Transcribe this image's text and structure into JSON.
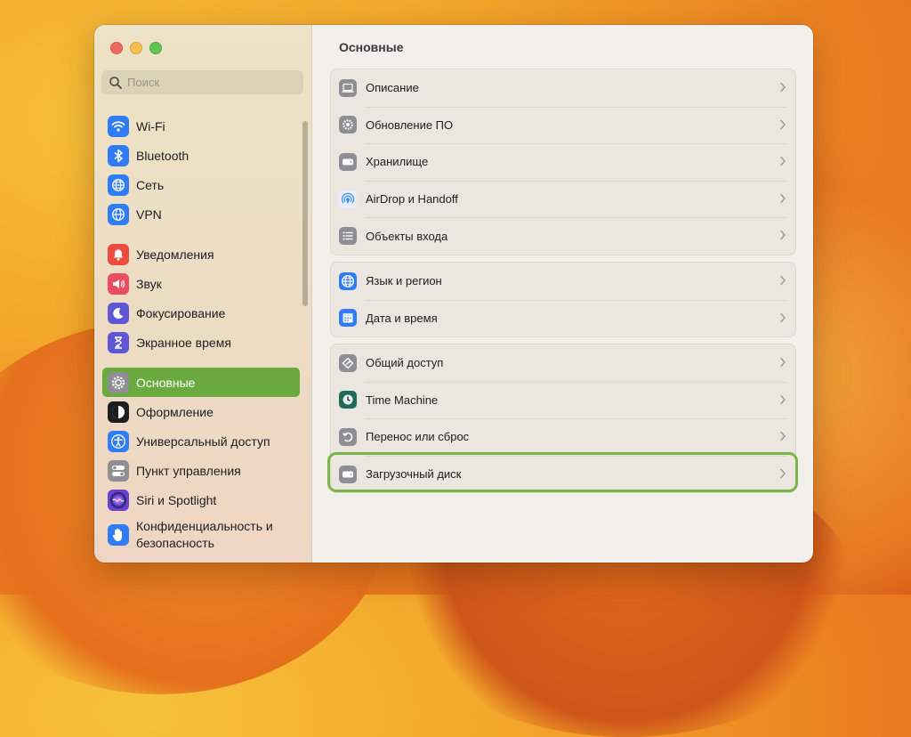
{
  "sidebar": {
    "search": {
      "placeholder": "Поиск"
    },
    "groups": [
      [
        {
          "label": "Wi-Fi",
          "icon": "wifi-icon",
          "color": "#2f7cf6"
        },
        {
          "label": "Bluetooth",
          "icon": "bluetooth-icon",
          "color": "#2f7cf6"
        },
        {
          "label": "Сеть",
          "icon": "globe-icon",
          "color": "#2f7cf6"
        },
        {
          "label": "VPN",
          "icon": "vpn-globe-icon",
          "color": "#2f7cf6"
        }
      ],
      [
        {
          "label": "Уведомления",
          "icon": "bell-icon",
          "color": "#eb4c3f"
        },
        {
          "label": "Звук",
          "icon": "speaker-icon",
          "color": "#eb4c5f"
        },
        {
          "label": "Фокусирование",
          "icon": "moon-icon",
          "color": "#5f56d6"
        },
        {
          "label": "Экранное время",
          "icon": "hourglass-icon",
          "color": "#5f56d6"
        }
      ],
      [
        {
          "label": "Основные",
          "icon": "gear-icon",
          "color": "#8e8e93",
          "selected": true
        },
        {
          "label": "Оформление",
          "icon": "appearance-icon",
          "color": "#1d1d1f"
        },
        {
          "label": "Универсальный доступ",
          "icon": "accessibility-icon",
          "color": "#2f7cf6"
        },
        {
          "label": "Пункт управления",
          "icon": "control-center-icon",
          "color": "#8e8e93"
        },
        {
          "label": "Siri и Spotlight",
          "icon": "siri-icon",
          "color": "#6a3fd1"
        },
        {
          "label": "Конфиденциальность и безопасность",
          "icon": "hand-icon",
          "color": "#2f7cf6"
        }
      ]
    ]
  },
  "main": {
    "title": "Основные",
    "groups": [
      [
        {
          "label": "Описание",
          "icon": "laptop-icon",
          "color": "#8e8e93"
        },
        {
          "label": "Обновление ПО",
          "icon": "software-update-icon",
          "color": "#8e8e93"
        },
        {
          "label": "Хранилище",
          "icon": "storage-icon",
          "color": "#8e8e93"
        },
        {
          "label": "AirDrop и Handoff",
          "icon": "airdrop-icon",
          "color": "#e9eefc"
        },
        {
          "label": "Объекты входа",
          "icon": "list-icon",
          "color": "#8e8e93"
        }
      ],
      [
        {
          "label": "Язык и регион",
          "icon": "globe-icon",
          "color": "#2f7cf6"
        },
        {
          "label": "Дата и время",
          "icon": "calendar-icon",
          "color": "#2f7cf6"
        }
      ],
      [
        {
          "label": "Общий доступ",
          "icon": "sharing-icon",
          "color": "#8e8e93"
        },
        {
          "label": "Time Machine",
          "icon": "time-machine-icon",
          "color": "#1f6b5a"
        },
        {
          "label": "Перенос или сброс",
          "icon": "reset-icon",
          "color": "#8e8e93"
        },
        {
          "label": "Загрузочный диск",
          "icon": "startup-disk-icon",
          "color": "#8e8e93",
          "highlighted": true
        }
      ]
    ]
  },
  "colors": {
    "selection": "#6aaa3f",
    "highlight_outline": "#7ab648"
  }
}
